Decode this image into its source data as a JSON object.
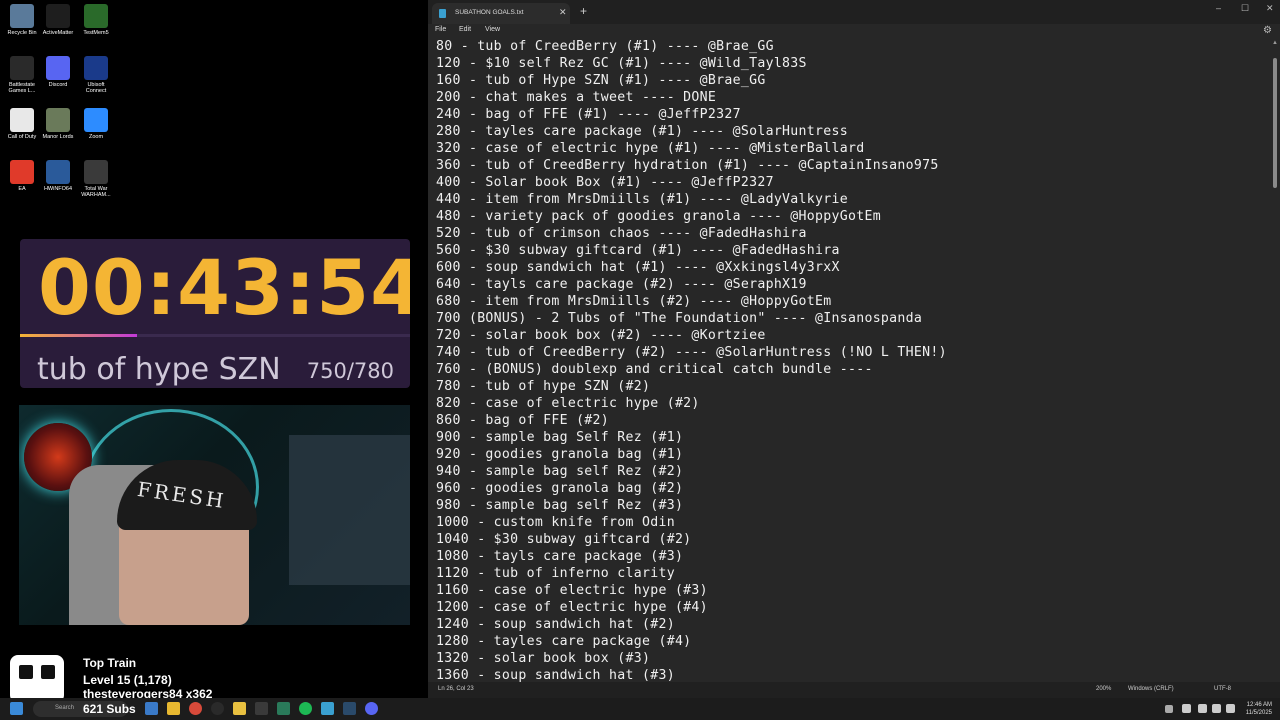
{
  "desktop": {
    "icons": [
      {
        "label": "Recycle Bin",
        "icon": "recycle-bin-icon",
        "color": "#5a7a9a"
      },
      {
        "label": "ActiveMatter",
        "icon": "activematter-icon",
        "color": "#1e1e1e"
      },
      {
        "label": "TestMem5",
        "icon": "testmem-icon",
        "color": "#2a6a2a"
      },
      {
        "label": "Battlestate Games L...",
        "icon": "battlestate-icon",
        "color": "#2a2a2a"
      },
      {
        "label": "Discord",
        "icon": "discord-icon",
        "color": "#5865f2"
      },
      {
        "label": "Ubisoft Connect",
        "icon": "ubisoft-icon",
        "color": "#1a3a8a"
      },
      {
        "label": "Call of Duty",
        "icon": "file-icon",
        "color": "#e8e8e8"
      },
      {
        "label": "Manor Lords",
        "icon": "manor-lords-icon",
        "color": "#6a7a5a"
      },
      {
        "label": "Zoom",
        "icon": "zoom-icon",
        "color": "#2d8cff"
      },
      {
        "label": "EA",
        "icon": "ea-icon",
        "color": "#e03a2a"
      },
      {
        "label": "HWiNFO64",
        "icon": "hwinfo-icon",
        "color": "#2a5a9a"
      },
      {
        "label": "Total War WARHAM...",
        "icon": "total-war-icon",
        "color": "#3a3a3a"
      }
    ]
  },
  "timer": {
    "value": "00:43:54",
    "goal_name": "tub of hype SZN",
    "goal_count": "750/780",
    "progress_fraction": 0.3,
    "accent": "#f4b534"
  },
  "webcam": {
    "hat_text": "FRESH"
  },
  "top_train": {
    "title": "Top Train",
    "level": "Level 15  (1,178)",
    "user": "thesteverogers84 x362",
    "subs": "621 Subs"
  },
  "notepad": {
    "tab_title": "SUBATHON GOALS.txt",
    "menu": [
      "File",
      "Edit",
      "View"
    ],
    "lines": [
      "80 - tub of CreedBerry (#1) ---- @Brae_GG",
      "120 - $10 self Rez GC (#1) ---- @Wild_Tayl83S",
      "160 - tub of Hype SZN (#1) ---- @Brae_GG",
      "200 - chat makes a tweet ---- DONE",
      "240 - bag of FFE (#1) ---- @JeffP2327",
      "280 - tayles care package (#1) ---- @SolarHuntress",
      "320 - case of electric hype (#1) ---- @MisterBallard",
      "360 - tub of CreedBerry hydration (#1) ---- @CaptainInsano975",
      "400 - Solar book Box (#1) ---- @JeffP2327",
      "440 - item from MrsDmiills (#1) ---- @LadyValkyrie",
      "480 - variety pack of goodies granola ---- @HoppyGotEm",
      "520 - tub of crimson chaos ---- @FadedHashira",
      "560 - $30 subway giftcard (#1) ---- @FadedHashira",
      "600 - soup sandwich hat (#1) ---- @Xxkingsl4y3rxX",
      "640 - tayls care package (#2) ---- @SeraphX19",
      "680 - item from MrsDmiills (#2) ---- @HoppyGotEm",
      "700 (BONUS) - 2 Tubs of \"The Foundation\" ---- @Insanospanda",
      "720 - solar book box (#2) ---- @Kortziee",
      "740 - tub of CreedBerry (#2) ---- @SolarHuntress (!NO L THEN!)",
      "760 - (BONUS) doublexp and critical catch bundle ----",
      "780 - tub of hype SZN (#2)",
      "820 - case of electric hype (#2)",
      "860 - bag of FFE (#2)",
      "900 - sample bag Self Rez (#1)",
      "920 - goodies granola bag (#1)",
      "940 - sample bag self Rez (#2)",
      "960 - goodies granola bag (#2)",
      "980 - sample bag self Rez (#3)",
      "1000 - custom knife from Odin",
      "1040 - $30 subway giftcard (#2)",
      "1080 - tayls care package (#3)",
      "1120 - tub of inferno clarity",
      "1160 - case of electric hype (#3)",
      "1200 - case of electric hype (#4)",
      "1240 - soup sandwich hat (#2)",
      "1280 - tayles care package (#4)",
      "1320 - solar book box (#3)",
      "1360 - soup sandwich hat (#3)"
    ],
    "status": {
      "position": "Ln 26, Col 23",
      "zoom": "200%",
      "line_endings": "Windows (CRLF)",
      "encoding": "UTF-8"
    }
  },
  "taskbar": {
    "search_label": "Search",
    "time": "12:46 AM",
    "date": "11/5/2025"
  }
}
